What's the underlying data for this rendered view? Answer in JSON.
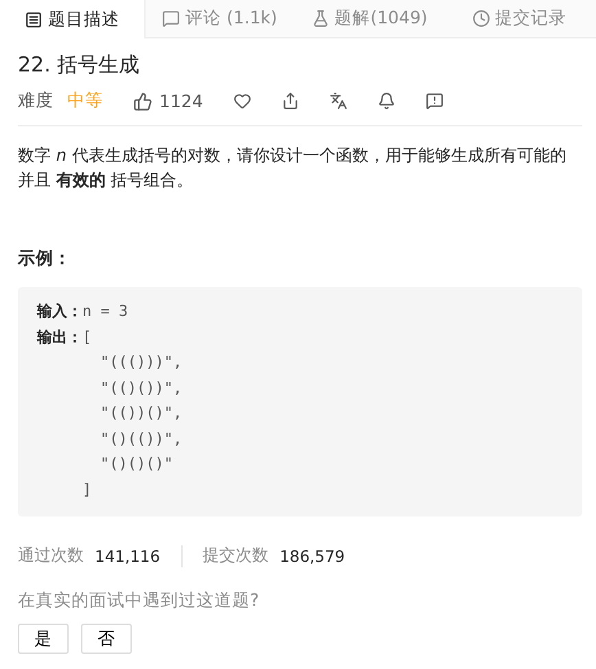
{
  "tabs": [
    {
      "label": "题目描述",
      "selected": true
    },
    {
      "label": "评论 (1.1k)",
      "selected": false
    },
    {
      "label": "题解(1049)",
      "selected": false
    },
    {
      "label": "提交记录",
      "selected": false
    }
  ],
  "problem": {
    "title": "22. 括号生成",
    "difficulty_label": "难度",
    "difficulty": "中等",
    "likes": "1124"
  },
  "description": "数字 *n* 代表生成括号的对数，请你设计一个函数，用于能够生成所有可能的并且 **有效的** 括号组合。",
  "example": {
    "heading": "示例：",
    "input_label": "输入：",
    "input": "n = 3",
    "output_label": "输出：",
    "output_open": "[",
    "output_items": [
      "\"((()))\",",
      "\"(()())\",",
      "\"(())()\",",
      "\"()(())\",",
      "\"()()()\""
    ],
    "output_close": "]"
  },
  "stats": [
    {
      "label": "通过次数",
      "value": "141,116"
    },
    {
      "label": "提交次数",
      "value": "186,579"
    }
  ],
  "question": "在真实的面试中遇到过这道题?",
  "answers": [
    "是",
    "否"
  ]
}
